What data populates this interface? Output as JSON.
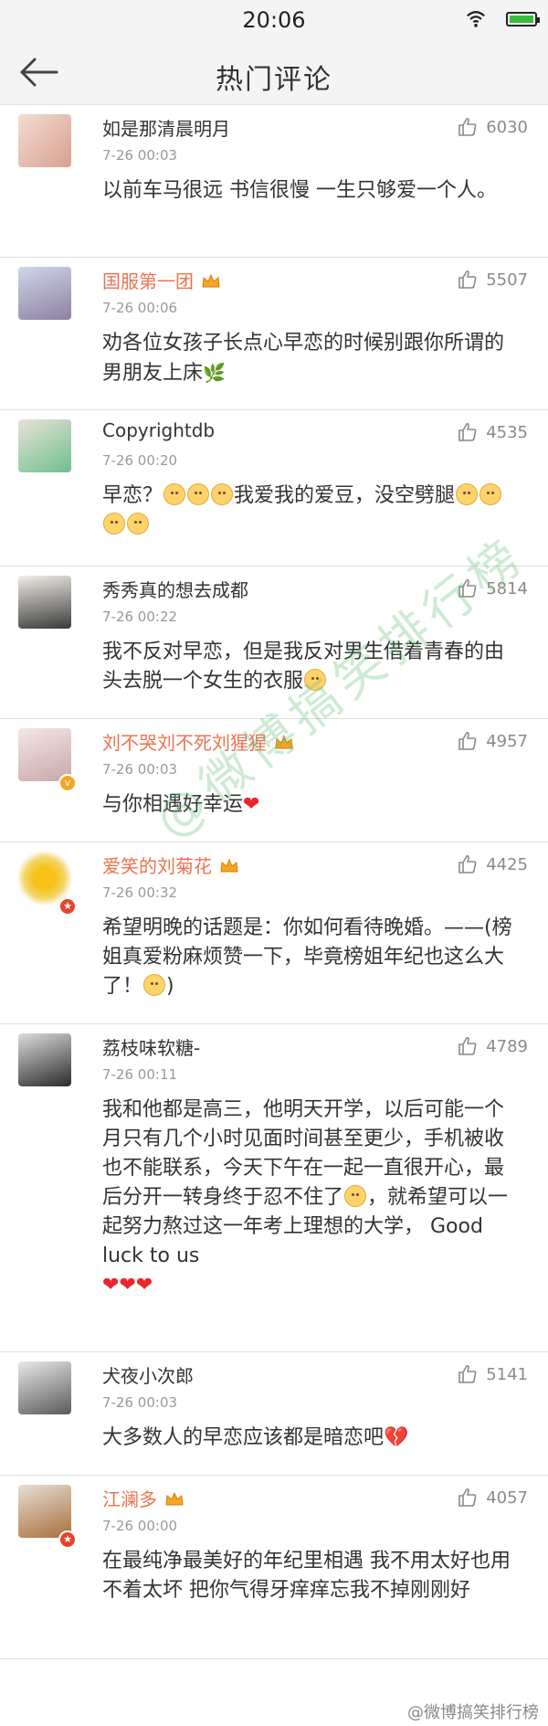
{
  "status_bar": {
    "time": "20:06"
  },
  "header": {
    "title": "热门评论",
    "back_icon": "back-arrow-icon"
  },
  "colors": {
    "orange_name": "#eb7350",
    "like_gray": "#8a8a8a"
  },
  "comments": [
    {
      "user": "如是那清晨明月",
      "time": "7-26 00:03",
      "likes": "6030",
      "text": "以前车马很远 书信很慢 一生只够爱一个人。"
    },
    {
      "user": "国服第一团",
      "time": "7-26 00:06",
      "likes": "5507",
      "text": "劝各位女孩子长点心早恋的时候别跟你所谓的男朋友上床"
    },
    {
      "user": "Copyrightdb",
      "time": "7-26 00:20",
      "likes": "4535",
      "text_a": "早恋？",
      "text_b": "我爱我的爱豆，没空劈腿"
    },
    {
      "user": "秀秀真的想去成都",
      "time": "7-26 00:22",
      "likes": "5814",
      "text": "我不反对早恋，但是我反对男生借着青春的由头去脱一个女生的衣服"
    },
    {
      "user": "刘不哭刘不死刘猩猩",
      "time": "7-26 00:03",
      "likes": "4957",
      "text": "与你相遇好幸运"
    },
    {
      "user": "爱笑的刘菊花",
      "time": "7-26 00:32",
      "likes": "4425",
      "text": "希望明晚的话题是：你如何看待晚婚。——(榜姐真爱粉麻烦赞一下，毕竟榜姐年纪也这么大了！"
    },
    {
      "user": "荔枝味软糖-",
      "time": "7-26 00:11",
      "likes": "4789",
      "text_a": "我和他都是高三，他明天开学，以后可能一个月只有几个小时见面时间甚至更少，手机被收也不能联系，今天下午在一起一直很开心，最后分开一转身终于忍不住了",
      "text_b": "，就希望可以一起努力熬过这一年考上理想的大学， Good luck to us"
    },
    {
      "user": "犬夜小次郎",
      "time": "7-26 00:03",
      "likes": "5141",
      "text": "大多数人的早恋应该都是暗恋吧"
    },
    {
      "user": "江澜多",
      "time": "7-26 00:00",
      "likes": "4057",
      "text": "在最纯净最美好的年纪里相遇 我不用太好也用不着太坏 把你气得牙痒痒忘我不掉刚刚好"
    }
  ],
  "watermark": {
    "diagonal": "@微博搞笑排行榜",
    "corner": "@微博搞笑排行榜"
  }
}
